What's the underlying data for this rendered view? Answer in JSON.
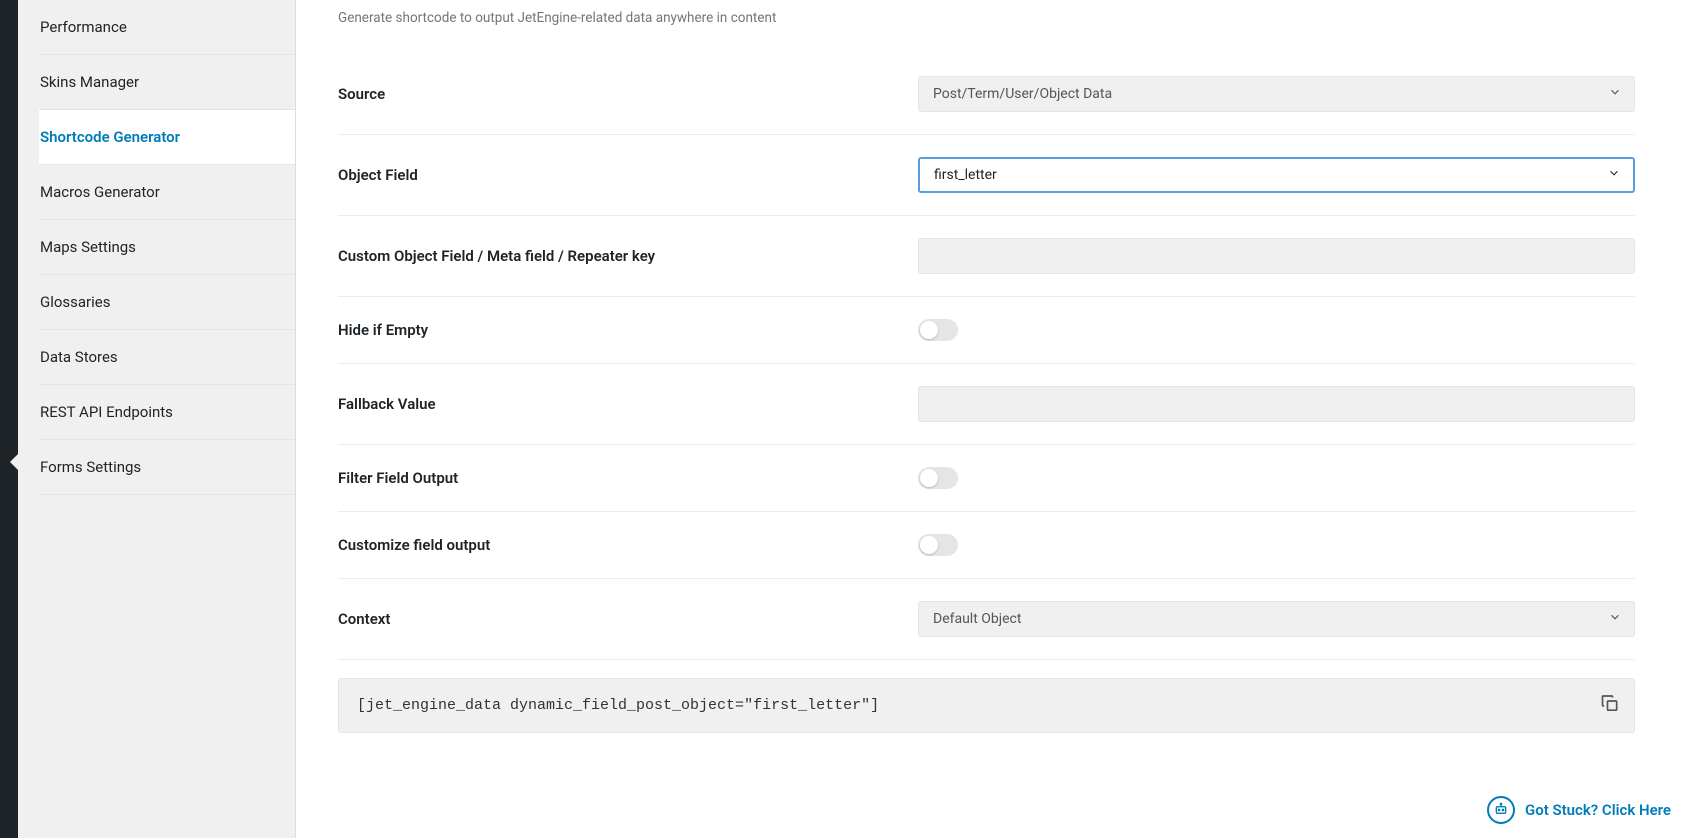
{
  "sidebar": {
    "items": [
      {
        "label": "Performance"
      },
      {
        "label": "Skins Manager"
      },
      {
        "label": "Shortcode Generator",
        "active": true
      },
      {
        "label": "Macros Generator"
      },
      {
        "label": "Maps Settings"
      },
      {
        "label": "Glossaries"
      },
      {
        "label": "Data Stores"
      },
      {
        "label": "REST API Endpoints"
      },
      {
        "label": "Forms Settings"
      }
    ]
  },
  "main": {
    "subtitle": "Generate shortcode to output JetEngine-related data anywhere in content",
    "fields": {
      "source": {
        "label": "Source",
        "value": "Post/Term/User/Object Data"
      },
      "object_field": {
        "label": "Object Field",
        "value": "first_letter"
      },
      "custom_object": {
        "label": "Custom Object Field / Meta field / Repeater key",
        "value": ""
      },
      "hide_if_empty": {
        "label": "Hide if Empty",
        "on": false
      },
      "fallback": {
        "label": "Fallback Value",
        "value": ""
      },
      "filter_output": {
        "label": "Filter Field Output",
        "on": false
      },
      "customize_output": {
        "label": "Customize field output",
        "on": false
      },
      "context": {
        "label": "Context",
        "value": "Default Object"
      }
    },
    "shortcode": "[jet_engine_data dynamic_field_post_object=\"first_letter\"]"
  },
  "help": {
    "label": "Got Stuck? Click Here"
  }
}
